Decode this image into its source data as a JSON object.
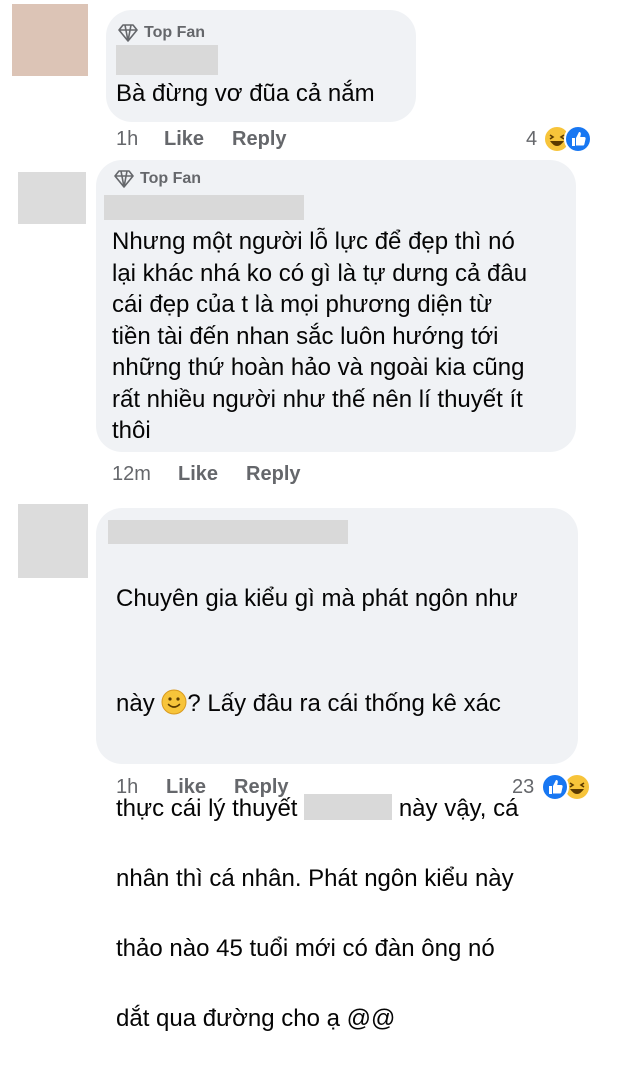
{
  "comments": [
    {
      "badge": "Top Fan",
      "text": "Bà đừng vơ đũa cả nắm",
      "time": "1h",
      "like_label": "Like",
      "reply_label": "Reply",
      "reaction_count": "4",
      "reactions": [
        "haha-icon",
        "like-icon"
      ]
    },
    {
      "badge": "Top Fan",
      "text": "Nhưng một người lỗ lực để đẹp thì nó\nlại khác nhá ko có gì là tự dưng cả đâu\ncái đẹp của t là mọi phương diện từ\ntiền tài đến nhan sắc luôn hướng tới\nnhững thứ hoàn hảo và ngoài kia cũng\nrất nhiều người như thế nên lí thuyết ít\nthôi",
      "time": "12m",
      "like_label": "Like",
      "reply_label": "Reply"
    },
    {
      "text_line1": "Chuyên gia kiểu gì mà phát ngôn như",
      "text_line2a": "này ",
      "text_line2b": "? Lấy đâu ra cái thống kê xác",
      "text_line3a": "thực cái lý thuyết ",
      "text_line3b": " này vậy, cá",
      "text_line4": "nhân thì cá nhân. Phát ngôn kiểu này",
      "text_line5": "thảo nào 45 tuổi mới có đàn ông nó",
      "text_line6": "dắt qua đường cho ạ @@",
      "time": "1h",
      "like_label": "Like",
      "reply_label": "Reply",
      "reaction_count": "23",
      "reactions": [
        "like-icon",
        "haha-icon"
      ]
    }
  ],
  "colors": {
    "bubble": "#f0f2f5",
    "meta": "#65676b",
    "like_blue": "#1877f2",
    "haha_yellow": "#f7c43a"
  }
}
